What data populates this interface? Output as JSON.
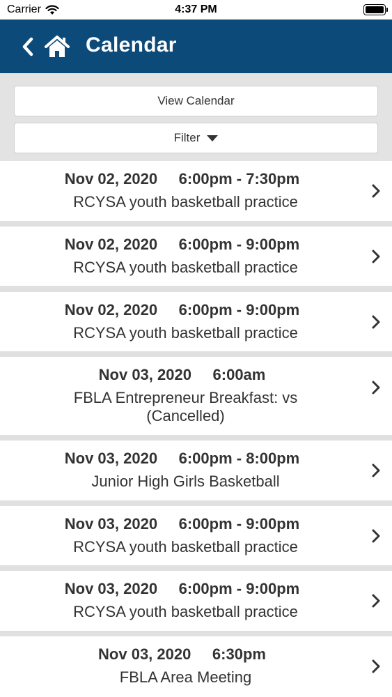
{
  "status": {
    "carrier": "Carrier",
    "time": "4:37 PM"
  },
  "nav": {
    "title": "Calendar"
  },
  "controls": {
    "view_label": "View Calendar",
    "filter_label": "Filter"
  },
  "colors": {
    "nav_bg": "#0c4a7a",
    "page_bg": "#e0e0e0"
  },
  "events": [
    {
      "date": "Nov 02, 2020",
      "time": "6:00pm - 7:30pm",
      "title": "RCYSA youth basketball practice"
    },
    {
      "date": "Nov 02, 2020",
      "time": "6:00pm - 9:00pm",
      "title": "RCYSA youth basketball practice"
    },
    {
      "date": "Nov 02, 2020",
      "time": "6:00pm - 9:00pm",
      "title": "RCYSA youth basketball practice"
    },
    {
      "date": "Nov 03, 2020",
      "time": "6:00am",
      "title": "FBLA Entrepreneur Breakfast: vs (Cancelled)"
    },
    {
      "date": "Nov 03, 2020",
      "time": "6:00pm - 8:00pm",
      "title": "Junior High Girls Basketball"
    },
    {
      "date": "Nov 03, 2020",
      "time": "6:00pm - 9:00pm",
      "title": "RCYSA youth basketball practice"
    },
    {
      "date": "Nov 03, 2020",
      "time": "6:00pm - 9:00pm",
      "title": "RCYSA youth basketball practice"
    },
    {
      "date": "Nov 03, 2020",
      "time": "6:30pm",
      "title": "FBLA Area Meeting"
    }
  ]
}
